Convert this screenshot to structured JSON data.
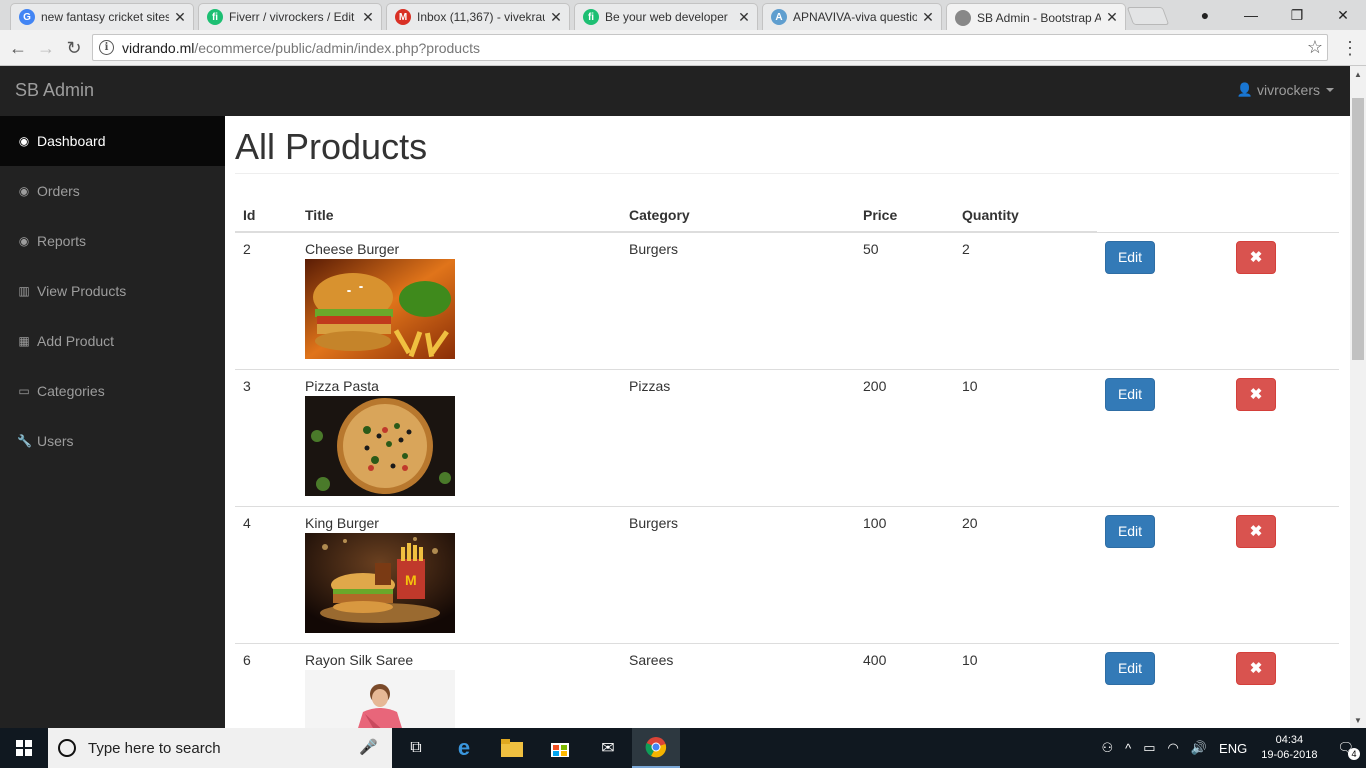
{
  "browser": {
    "tabs": [
      {
        "title": "new fantasy cricket sites",
        "favicon": "google-g-icon",
        "color": "#4285f4",
        "glyph": "G",
        "active": false
      },
      {
        "title": "Fiverr / vivrockers / Edit",
        "favicon": "fiverr-icon",
        "color": "#1dbf73",
        "glyph": "fi",
        "active": false
      },
      {
        "title": "Inbox (11,367) - vivekrau",
        "favicon": "gmail-icon",
        "color": "#d93025",
        "glyph": "M",
        "active": false
      },
      {
        "title": "Be your web developer",
        "favicon": "fiverr-icon",
        "color": "#1dbf73",
        "glyph": "fi",
        "active": false
      },
      {
        "title": "APNAVIVA-viva question",
        "favicon": "apnaviva-icon",
        "color": "#5f9ecf",
        "glyph": "A",
        "active": false
      },
      {
        "title": "SB Admin - Bootstrap A",
        "favicon": "page-icon",
        "color": "#888888",
        "glyph": "",
        "active": true
      }
    ],
    "url_host": "vidrando.ml",
    "url_path": "/ecommerce/public/admin/index.php?products"
  },
  "app": {
    "brand": "SB Admin",
    "user": "vivrockers"
  },
  "sidebar": {
    "items": [
      {
        "label": "Dashboard",
        "icon": "dashboard-icon",
        "glyph": "◉",
        "active": true
      },
      {
        "label": "Orders",
        "icon": "dashboard-icon",
        "glyph": "◉",
        "active": false
      },
      {
        "label": "Reports",
        "icon": "dashboard-icon",
        "glyph": "◉",
        "active": false
      },
      {
        "label": "View Products",
        "icon": "bar-chart-icon",
        "glyph": "▥",
        "active": false
      },
      {
        "label": "Add Product",
        "icon": "table-icon",
        "glyph": "▦",
        "active": false
      },
      {
        "label": "Categories",
        "icon": "desktop-icon",
        "glyph": "▭",
        "active": false
      },
      {
        "label": "Users",
        "icon": "wrench-icon",
        "glyph": "🔧",
        "active": false
      }
    ]
  },
  "main": {
    "title": "All Products",
    "columns": [
      "Id",
      "Title",
      "Category",
      "Price",
      "Quantity"
    ],
    "edit_label": "Edit",
    "delete_glyph": "✖",
    "rows": [
      {
        "id": "2",
        "title": "Cheese Burger",
        "category": "Burgers",
        "price": "50",
        "quantity": "2",
        "image": "burger-photo"
      },
      {
        "id": "3",
        "title": "Pizza Pasta",
        "category": "Pizzas",
        "price": "200",
        "quantity": "10",
        "image": "pizza-photo"
      },
      {
        "id": "4",
        "title": "King Burger",
        "category": "Burgers",
        "price": "100",
        "quantity": "20",
        "image": "burger-fries-photo"
      },
      {
        "id": "6",
        "title": "Rayon Silk Saree",
        "category": "Sarees",
        "price": "400",
        "quantity": "10",
        "image": "saree-photo"
      }
    ]
  },
  "taskbar": {
    "search_placeholder": "Type here to search",
    "language": "ENG",
    "time": "04:34",
    "date": "19-06-2018",
    "notifications": "4"
  }
}
